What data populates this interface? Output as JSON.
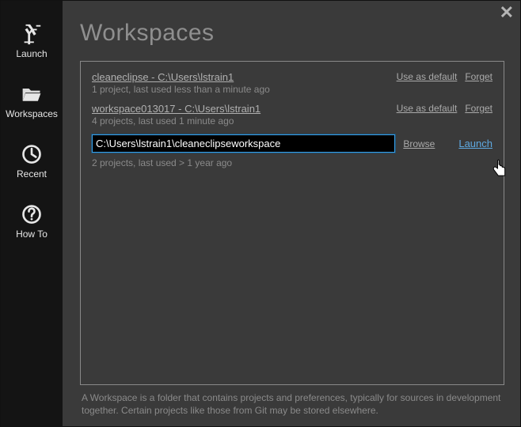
{
  "close_label": "✕",
  "sidebar": {
    "items": [
      {
        "key": "launch",
        "label": "Launch",
        "icon": "run-icon"
      },
      {
        "key": "workspaces",
        "label": "Workspaces",
        "icon": "folder-open-icon"
      },
      {
        "key": "recent",
        "label": "Recent",
        "icon": "clock-icon"
      },
      {
        "key": "howto",
        "label": "How To",
        "icon": "question-icon"
      }
    ]
  },
  "page": {
    "title": "Workspaces",
    "workspaces": [
      {
        "name": "cleaneclipse - C:\\Users\\lstrain1",
        "meta": "1 project, last used less than a minute ago",
        "use_default_label": "Use as default",
        "forget_label": "Forget"
      },
      {
        "name": "workspace013017 - C:\\Users\\lstrain1",
        "meta": "4 projects, last used 1 minute ago",
        "use_default_label": "Use as default",
        "forget_label": "Forget"
      }
    ],
    "path_input_value": "C:\\Users\\lstrain1\\cleaneclipseworkspace",
    "browse_label": "Browse",
    "launch_label": "Launch",
    "below_meta": "2 projects, last used > 1 year ago",
    "footer": "A Workspace is a folder that contains projects and preferences, typically for sources in development together. Certain projects like those from Git may be stored elsewhere."
  }
}
